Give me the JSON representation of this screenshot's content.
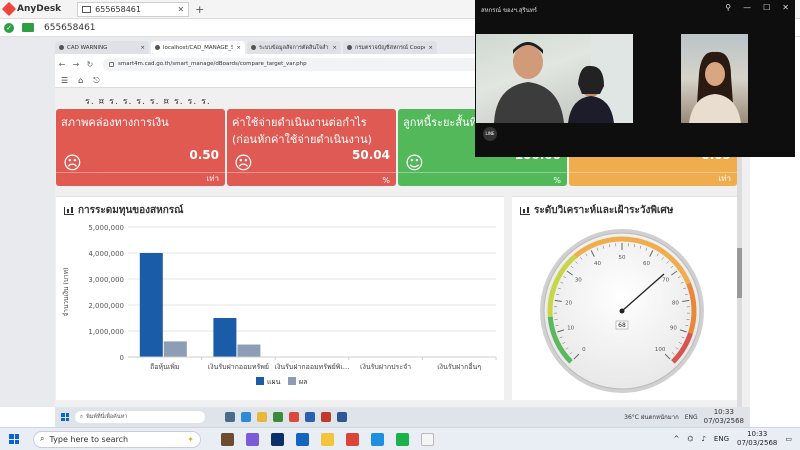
{
  "anydesk": {
    "app_name": "AnyDesk",
    "tab_id": "655658461",
    "session_id": "655658461"
  },
  "browser": {
    "tabs": [
      {
        "label": "CAD WARNING"
      },
      {
        "label": "localhost/CAD_MANAGE_S..."
      },
      {
        "label": "ระบบข้อมูลสัจการตัดสินใจสำหรั..."
      },
      {
        "label": "กรมตรวจบัญชีสหกรณ์ Cooper..."
      }
    ],
    "url": "smart4m.cad.go.th/smart_manage/dBoards/compare_target_var.php"
  },
  "page": {
    "blurred_title": "ร. ¤ ร. ร. ร. ร. ¤ ร. ร. ร.",
    "cards": [
      {
        "title": "สภาพคล่องทางการเงิน",
        "value": "0.50",
        "unit": "เท่า",
        "color": "#e05a52",
        "face": "☹"
      },
      {
        "title": "ค่าใช้จ่ายดำเนินงานต่อกำไร (ก่อนหักค่าใช้จ่ายดำเนินงาน)",
        "value": "50.04",
        "unit": "%",
        "color": "#df5a52",
        "face": "☹"
      },
      {
        "title": "ลูกหนี้ระยะสั้นที่ร",
        "value": "100.00",
        "unit": "%",
        "color": "#53b85a",
        "face": "☺"
      },
      {
        "title": "",
        "value": "0.09",
        "unit": "เท่า",
        "color": "#efad4d",
        "face": ""
      }
    ],
    "left_panel_title": "การระดมทุนของสหกรณ์",
    "right_panel_title": "ระดับวิเคราะห์และเฝ้าระวังพิเศษ"
  },
  "chart_data": {
    "type": "bar",
    "categories": [
      "ถือหุ้นเพิ่ม",
      "เงินรับฝากออมทรัพย์",
      "เงินรับฝากออมทรัพย์พิเ...",
      "เงินรับฝากประจำ",
      "เงินรับฝากอื่นๆ"
    ],
    "series": [
      {
        "name": "แผน",
        "values": [
          4000000,
          1500000,
          0,
          0,
          0
        ]
      },
      {
        "name": "ผล",
        "values": [
          600000,
          480000,
          0,
          0,
          0
        ]
      }
    ],
    "ylabel": "จำนวนเงิน (บาท)",
    "ylim": [
      0,
      5000000
    ],
    "yticks": [
      "0",
      "1,000,000",
      "2,000,000",
      "3,000,000",
      "4,000,000",
      "5,000,000"
    ],
    "colors": [
      "#1a5ca8",
      "#8c9db5"
    ],
    "legend": "bottom"
  },
  "gauge": {
    "value": 68,
    "value_label": "68",
    "min": 0,
    "max": 100,
    "tick_labels": [
      "0",
      "10",
      "20",
      "30",
      "40",
      "50",
      "60",
      "70",
      "80",
      "90",
      "100"
    ]
  },
  "vcall": {
    "title": "สหกรณ์ ของฯ.สุรินทร์",
    "line_badge": "LINE"
  },
  "remote_taskbar": {
    "search_placeholder": "พิมพ์ที่นี่เพื่อค้นหา",
    "weather": "36°C ฝนตกหนักมาก",
    "lang": "ENG",
    "time": "10:33",
    "date": "07/03/2568"
  },
  "local_taskbar": {
    "search_placeholder": "Type here to search",
    "lang": "ENG",
    "time": "10:33",
    "date": "07/03/2568"
  }
}
